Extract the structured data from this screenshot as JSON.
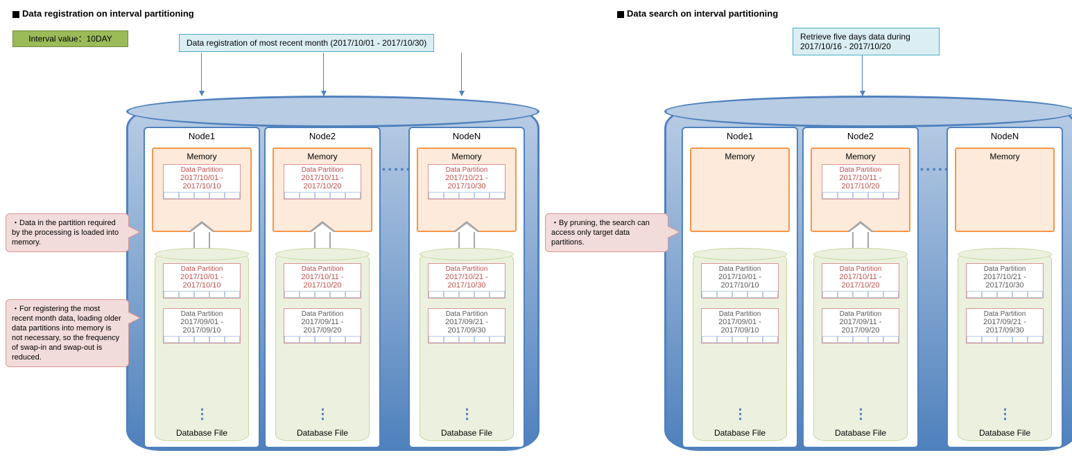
{
  "left": {
    "title": "Data registration on interval partitioning",
    "interval": "Interval value：10DAY",
    "topbox": "Data registration of most recent month (2017/10/01 - 2017/10/30)",
    "nodes": [
      {
        "label": "Node1",
        "mem_part": {
          "t": "Data Partition",
          "r": "2017/10/01 - 2017/10/10"
        },
        "db_parts": [
          {
            "t": "Data Partition",
            "r": "2017/10/01 - 2017/10/10",
            "a": true
          },
          {
            "t": "Data Partition",
            "r": "2017/09/01 - 2017/09/10",
            "a": false
          }
        ]
      },
      {
        "label": "Node2",
        "mem_part": {
          "t": "Data Partition",
          "r": "2017/10/11 - 2017/10/20"
        },
        "db_parts": [
          {
            "t": "Data Partition",
            "r": "2017/10/11 - 2017/10/20",
            "a": true
          },
          {
            "t": "Data Partition",
            "r": "2017/09/11 - 2017/09/20",
            "a": false
          }
        ]
      },
      {
        "label": "NodeN",
        "mem_part": {
          "t": "Data Partition",
          "r": "2017/10/21 - 2017/10/30"
        },
        "db_parts": [
          {
            "t": "Data Partition",
            "r": "2017/10/21 - 2017/10/30",
            "a": true
          },
          {
            "t": "Data Partition",
            "r": "2017/09/21 - 2017/09/30",
            "a": false
          }
        ]
      }
    ],
    "memory_label": "Memory",
    "db_label": "Database File",
    "callout1": "・Data in the partition required by the processing is loaded into memory.",
    "callout2": "・For registering the most recent month data, loading older data partitions into memory is not necessary, so the frequency of swap-in and swap-out is reduced."
  },
  "right": {
    "title": "Data search on interval partitioning",
    "topbox": "Retrieve five days data during 2017/10/16 - 2017/10/20",
    "nodes": [
      {
        "label": "Node1",
        "mem_part": null,
        "db_parts": [
          {
            "t": "Data Partition",
            "r": "2017/10/01 - 2017/10/10",
            "a": false
          },
          {
            "t": "Data Partition",
            "r": "2017/09/01 - 2017/09/10",
            "a": false
          }
        ]
      },
      {
        "label": "Node2",
        "mem_part": {
          "t": "Data Partition",
          "r": "2017/10/11 - 2017/10/20"
        },
        "db_parts": [
          {
            "t": "Data Partition",
            "r": "2017/10/11 - 2017/10/20",
            "a": true
          },
          {
            "t": "Data Partition",
            "r": "2017/09/11 - 2017/09/20",
            "a": false
          }
        ]
      },
      {
        "label": "NodeN",
        "mem_part": null,
        "db_parts": [
          {
            "t": "Data Partition",
            "r": "2017/10/21 - 2017/10/30",
            "a": false
          },
          {
            "t": "Data Partition",
            "r": "2017/09/21 - 2017/09/30",
            "a": false
          }
        ]
      }
    ],
    "memory_label": "Memory",
    "db_label": "Database File",
    "callout1": "・By pruning, the search can access only target data partitions."
  }
}
